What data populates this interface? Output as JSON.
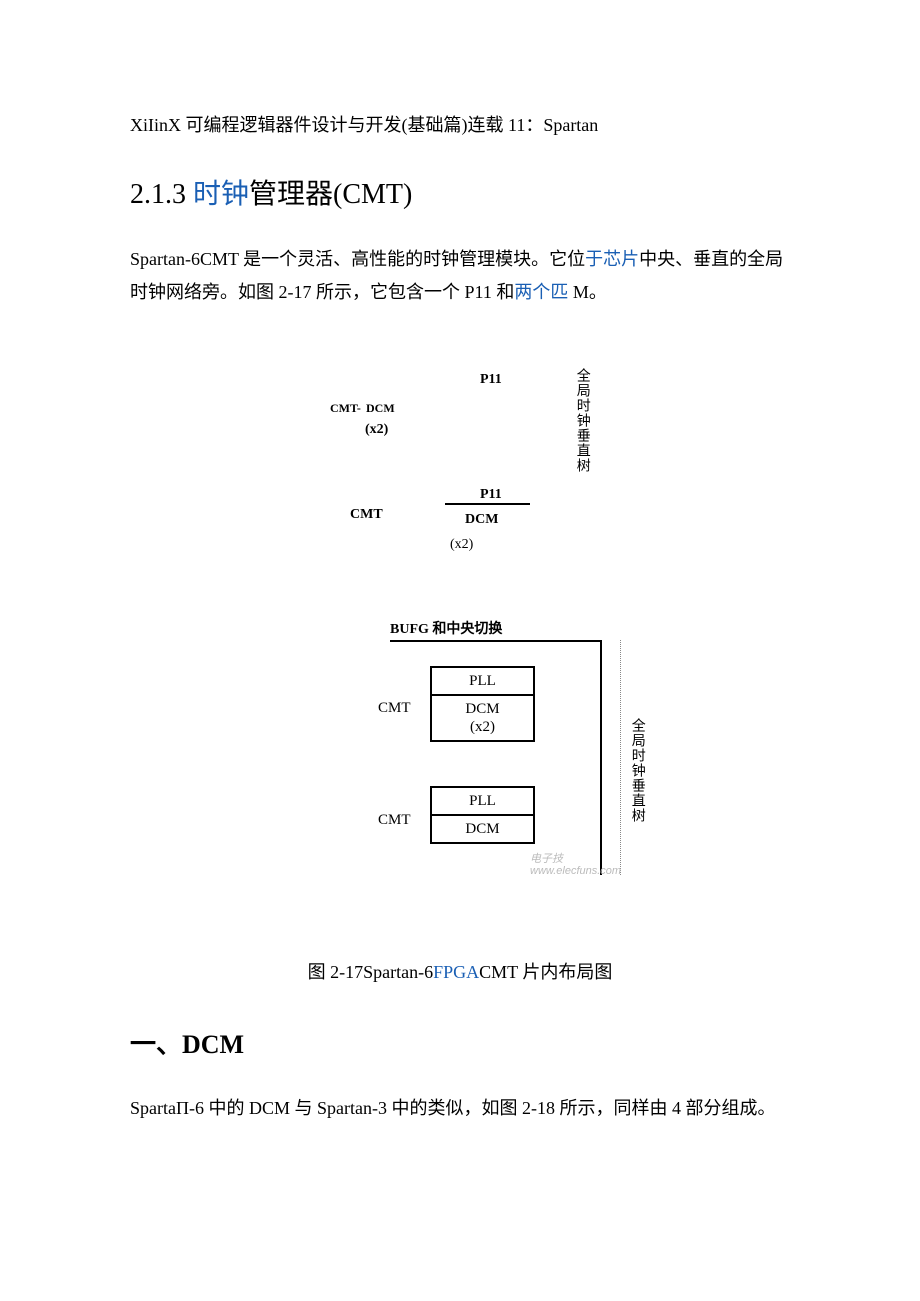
{
  "topline": {
    "prefix": "XiIinX 可编程逻辑器件设计与开发(基础篇)连载 11：Spartan"
  },
  "section": {
    "number": "2.1.3 ",
    "link": "时钟",
    "tail": "管理器(CMT)"
  },
  "intro": {
    "seg1": "Spartan-6CMT 是一个灵活、高性能的时钟管理模块。它位",
    "link1": "于芯片",
    "seg2": "中央、垂直的全局时钟网络旁。如图 2-17 所示，它包含一个 P11 和",
    "link2": "两个匹",
    "seg3": " M。"
  },
  "diagram_top": {
    "p11_top": "P11",
    "cmt_dcm": "CMT-",
    "dcm": "DCM",
    "x2": "(x2)",
    "cmt": "CMT",
    "p11_mid": "P11",
    "dcm_mid": "DCM",
    "x2_mid": "(x2)",
    "vlabel": "全局时钟垂直树"
  },
  "diagram_bottom": {
    "title": "BUFG 和中央切换",
    "cmt1": "CMT",
    "cmt2": "CMT",
    "pll": "PLL",
    "dcm_x2": "DCM\n(x2)",
    "dcm": "DCM",
    "vlabel": "全局时钟垂直树",
    "watermark1": "电子技",
    "watermark2": "www.elecfuns.com"
  },
  "figure_caption": {
    "pre": "图 2-17Spartan-6",
    "link": "FPGA",
    "post": "CMT 片内布局图"
  },
  "sub_heading": "一、DCM",
  "last_para": "SpartaΠ-6 中的 DCM 与 Spartan-3 中的类似，如图 2-18 所示，同样由 4 部分组成。"
}
